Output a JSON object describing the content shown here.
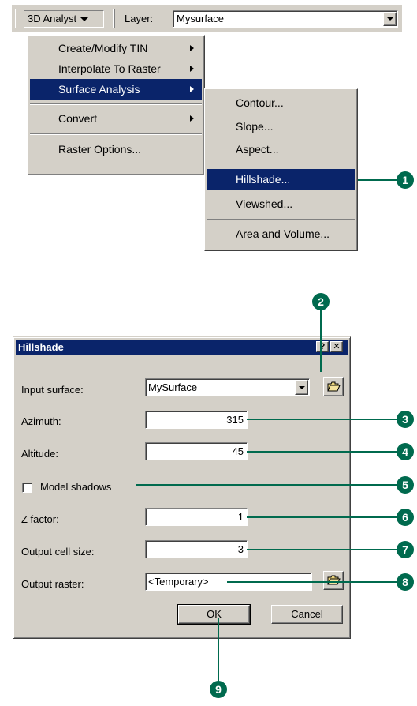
{
  "toolbar": {
    "menu_label": "3D Analyst",
    "layer_label": "Layer:",
    "layer_value": "Mysurface"
  },
  "menu": {
    "items": [
      {
        "label": "Create/Modify TIN",
        "submenu": true
      },
      {
        "label": "Interpolate To Raster",
        "submenu": true
      },
      {
        "label": "Surface Analysis",
        "submenu": true,
        "highlighted": true
      },
      {
        "label": "Convert",
        "submenu": true
      },
      {
        "label": "Raster Options..."
      }
    ]
  },
  "submenu": {
    "items": [
      {
        "label": "Contour..."
      },
      {
        "label": "Slope..."
      },
      {
        "label": "Aspect..."
      },
      {
        "label": "Hillshade...",
        "highlighted": true
      },
      {
        "label": "Viewshed..."
      },
      {
        "label": "Area and Volume..."
      }
    ]
  },
  "dialog": {
    "title": "Hillshade",
    "help_label": "?",
    "close_label": "✕",
    "input_surface_label": "Input surface:",
    "input_surface_value": "MySurface",
    "azimuth_label": "Azimuth:",
    "azimuth_value": "315",
    "altitude_label": "Altitude:",
    "altitude_value": "45",
    "model_shadows_label": "Model shadows",
    "model_shadows_checked": false,
    "z_factor_label": "Z factor:",
    "z_factor_value": "1",
    "cell_size_label": "Output cell size:",
    "cell_size_value": "3",
    "output_raster_label": "Output raster:",
    "output_raster_value": "<Temporary>",
    "ok_label": "OK",
    "cancel_label": "Cancel"
  },
  "callouts": [
    "1",
    "2",
    "3",
    "4",
    "5",
    "6",
    "7",
    "8",
    "9"
  ],
  "colors": {
    "highlight": "#0a246a",
    "callout": "#006a4e",
    "face": "#d4d0c8"
  }
}
